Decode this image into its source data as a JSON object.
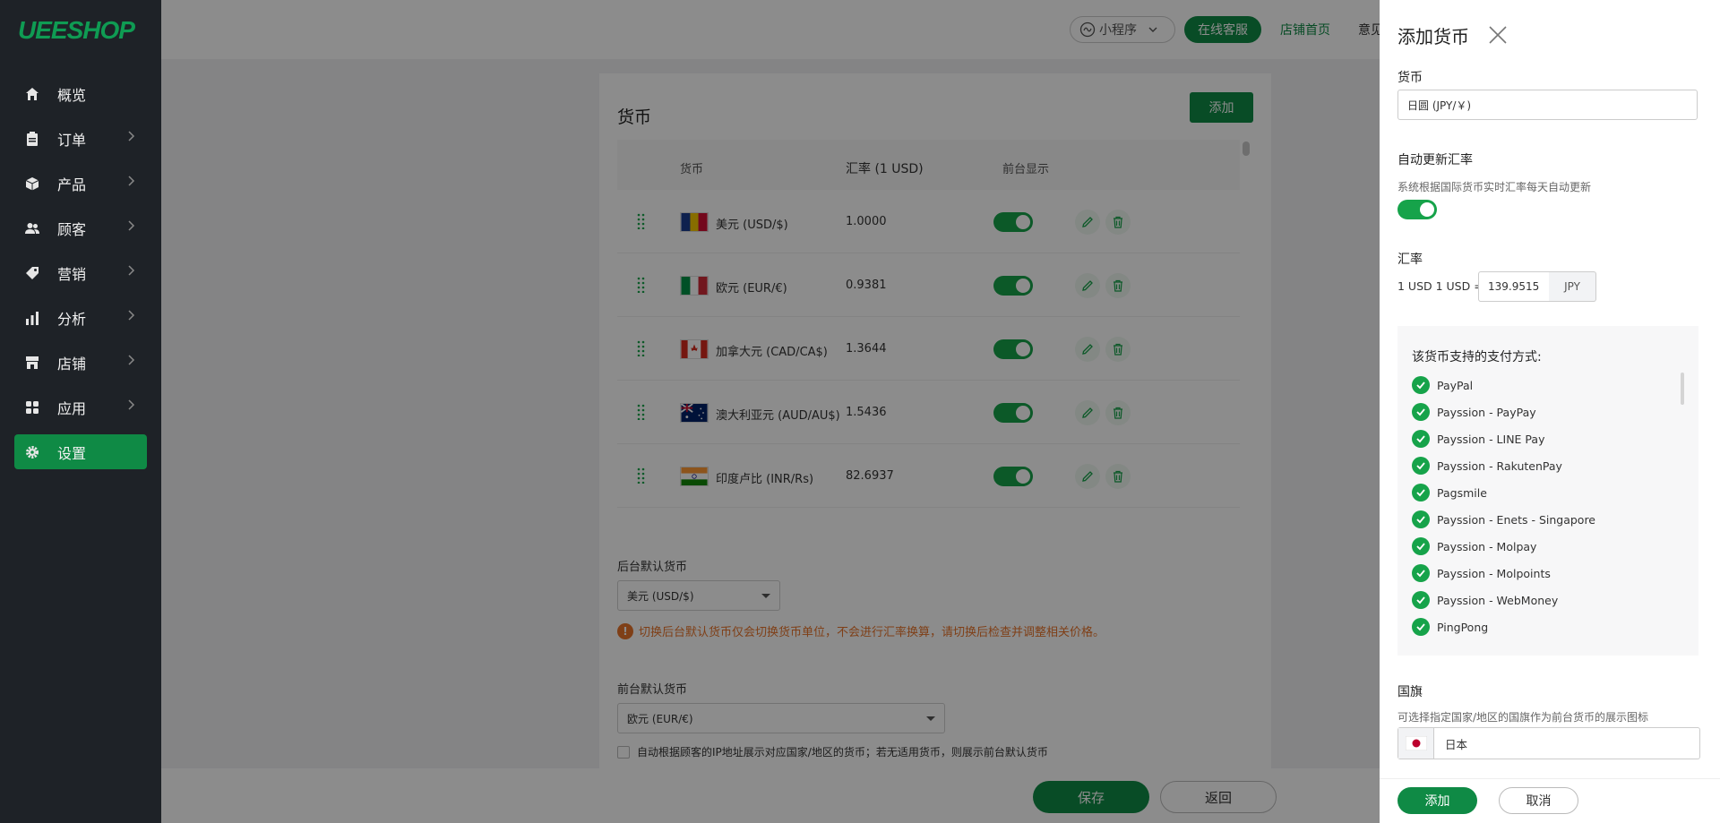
{
  "sidebar": {
    "logo": "UEESHOP",
    "items": [
      {
        "label": "概览"
      },
      {
        "label": "订单"
      },
      {
        "label": "产品"
      },
      {
        "label": "顾客"
      },
      {
        "label": "营销"
      },
      {
        "label": "分析"
      },
      {
        "label": "店铺"
      },
      {
        "label": "应用"
      },
      {
        "label": "设置"
      }
    ]
  },
  "topbar": {
    "mini_program": "小程序",
    "online_service": "在线客服",
    "store_home": "店铺首页",
    "feedback_partial": "意见"
  },
  "currency_section": {
    "title": "货币",
    "add_button": "添加",
    "columns": {
      "currency": "货币",
      "rate": "汇率 (1 USD)",
      "display": "前台显示"
    },
    "rows": [
      {
        "name": "美元 (USD/$)",
        "rate": "1.0000",
        "visible": true
      },
      {
        "name": "欧元 (EUR/€)",
        "rate": "0.9381",
        "visible": true
      },
      {
        "name": "加拿大元 (CAD/CA$)",
        "rate": "1.3644",
        "visible": true
      },
      {
        "name": "澳大利亚元 (AUD/AU$)",
        "rate": "1.5436",
        "visible": true
      },
      {
        "name": "印度卢比 (INR/Rs)",
        "rate": "82.6937",
        "visible": true
      }
    ],
    "backend_default_label": "后台默认货币",
    "backend_default_value": "美元 (USD/$)",
    "warning": "切换后台默认货币仅会切换货币单位，不会进行汇率换算，请切换后检查并调整相关价格。",
    "frontend_default_label": "前台默认货币",
    "frontend_default_value": "欧元 (EUR/€)",
    "auto_ip_label": "自动根据顾客的IP地址展示对应国家/地区的货币；若无适用货币，则展示前台默认货币"
  },
  "footer": {
    "save": "保存",
    "back": "返回"
  },
  "drawer": {
    "title": "添加货币",
    "currency_label": "货币",
    "currency_value": "日圆 (JPY/￥)",
    "auto_update_label": "自动更新汇率",
    "auto_update_desc": "系统根据国际货币实时汇率每天自动更新",
    "auto_update_on": true,
    "rate_label": "汇率",
    "rate_prefix": "1 USD 1 USD =",
    "rate_value": "139.9515",
    "rate_unit": "JPY",
    "payments_title": "该货币支持的支付方式:",
    "payments": [
      "PayPal",
      "Payssion - PayPay",
      "Payssion - LINE Pay",
      "Payssion - RakutenPay",
      "Pagsmile",
      "Payssion - Enets - Singapore",
      "Payssion - Molpay",
      "Payssion - Molpoints",
      "Payssion - WebMoney",
      "PingPong"
    ],
    "flag_label": "国旗",
    "flag_desc": "可选择指定国家/地区的国旗作为前台货币的展示图标",
    "flag_value": "日本",
    "add_button": "添加",
    "cancel_button": "取消"
  },
  "colors": {
    "accent": "#0f8a45",
    "toggle": "#16a34a",
    "warning": "#e8742a",
    "sidebar": "#1e2227"
  }
}
